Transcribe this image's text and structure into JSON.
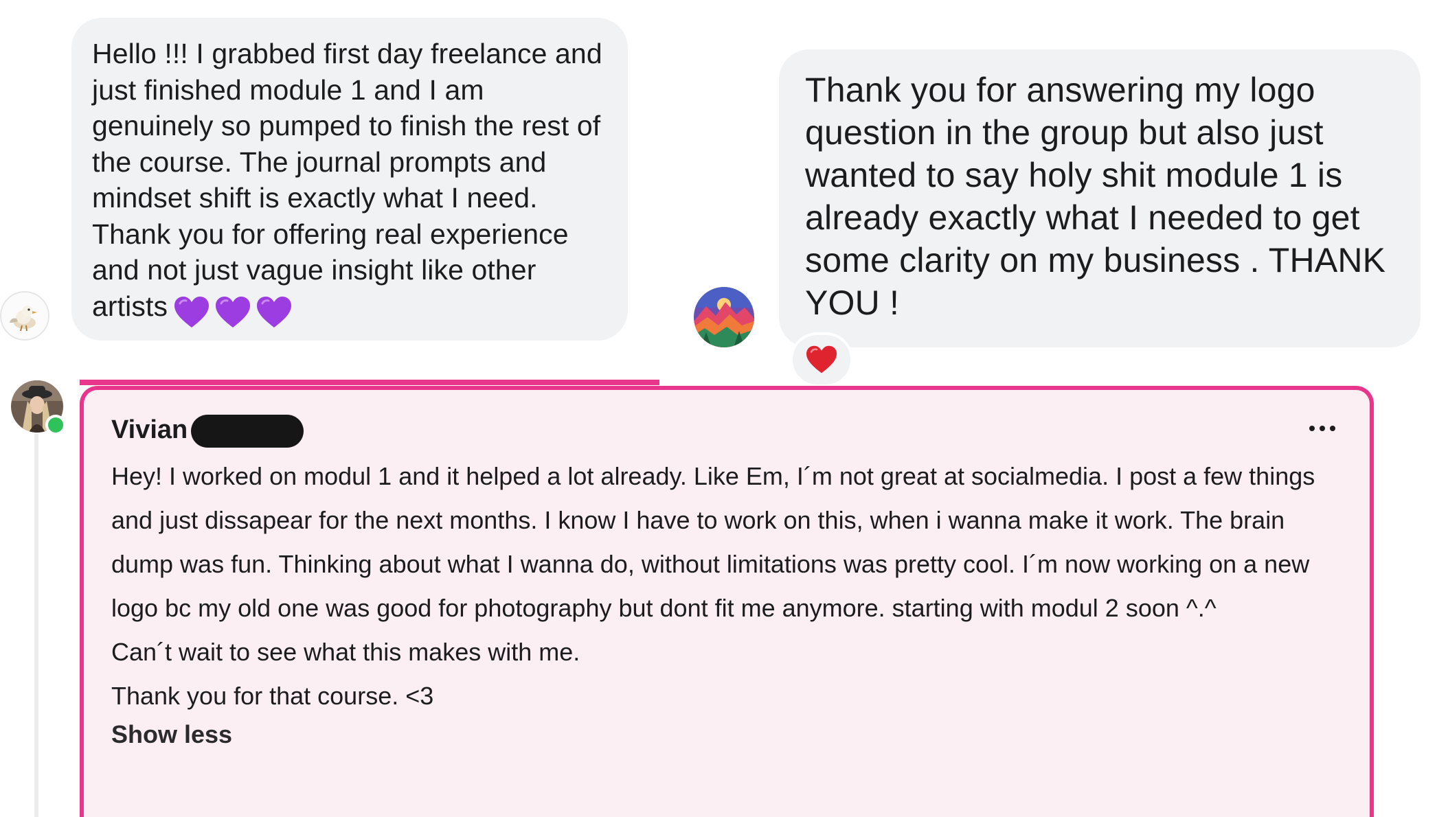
{
  "messages": {
    "left": {
      "text": "Hello !!! I grabbed first day freelance and just finished module 1 and I am genuinely so pumped to finish the rest of the course. The journal prompts and mindset shift is exactly what I need. Thank you for offering real experience and not just vague insight like other artists",
      "emoji": [
        "purple-heart",
        "purple-heart",
        "purple-heart"
      ],
      "avatar_icon": "bird-icon"
    },
    "right": {
      "text": "Thank you for answering my logo question in the group but also just wanted to say holy shit module 1 is already exactly what I needed to get some clarity on my business . THANK YOU !",
      "reaction": "red-heart",
      "avatar_icon": "landscape-avatar"
    }
  },
  "comment": {
    "author": "Vivian",
    "paragraphs": [
      "Hey! I worked on modul 1 and it helped a lot already. Like Em, I´m not great at socialmedia. I post a few things and just dissapear for the next months. I know I have to work on this, when i wanna make it work. The brain dump was fun. Thinking about what I wanna do, without limitations was pretty cool. I´m now working on a new logo bc my old one was good for photography but dont fit me anymore. starting with modul 2 soon ^.^",
      "Can´t wait to see what this makes with me.",
      "Thank you for that course. <3"
    ],
    "show_less_label": "Show less",
    "highlight_color": "#e8368c",
    "online_status_color": "#2fc25b"
  }
}
